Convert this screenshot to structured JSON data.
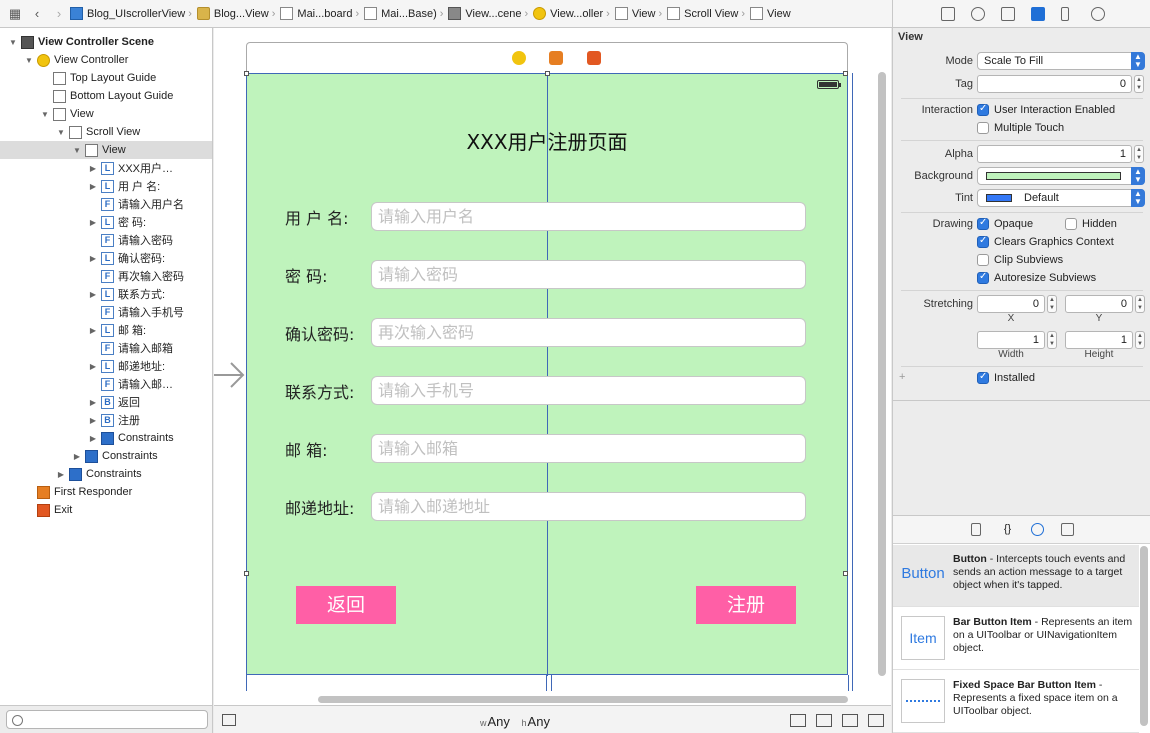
{
  "jumpbar": {
    "crumbs": [
      {
        "label": "Blog_UIscrollerView",
        "icon": "project-icon"
      },
      {
        "label": "Blog...View",
        "icon": "folder-icon"
      },
      {
        "label": "Mai...board",
        "icon": "storyboard-file-icon"
      },
      {
        "label": "Mai...Base)",
        "icon": "storyboard-file-icon"
      },
      {
        "label": "View...cene",
        "icon": "scene-icon"
      },
      {
        "label": "View...oller",
        "icon": "view-controller-icon"
      },
      {
        "label": "View",
        "icon": "view-icon"
      },
      {
        "label": "Scroll View",
        "icon": "view-icon"
      },
      {
        "label": "View",
        "icon": "view-icon"
      }
    ]
  },
  "outline": {
    "items": [
      {
        "label": "View Controller Scene",
        "indent": 0,
        "disclosure": "open",
        "icon": "scene-icon",
        "bold": true
      },
      {
        "label": "View Controller",
        "indent": 1,
        "disclosure": "open",
        "icon": "view-controller-icon"
      },
      {
        "label": "Top Layout Guide",
        "indent": 2,
        "disclosure": "none",
        "icon": "layout-guide-icon"
      },
      {
        "label": "Bottom Layout Guide",
        "indent": 2,
        "disclosure": "none",
        "icon": "layout-guide-icon"
      },
      {
        "label": "View",
        "indent": 2,
        "disclosure": "open",
        "icon": "view-icon"
      },
      {
        "label": "Scroll View",
        "indent": 3,
        "disclosure": "open",
        "icon": "view-icon"
      },
      {
        "label": "View",
        "indent": 4,
        "disclosure": "open",
        "icon": "view-icon",
        "selected": true
      },
      {
        "label": "XXX用户…",
        "indent": 5,
        "disclosure": "closed",
        "icon": "label-icon",
        "glyph": "L"
      },
      {
        "label": "用 户 名:",
        "indent": 5,
        "disclosure": "closed",
        "icon": "label-icon",
        "glyph": "L"
      },
      {
        "label": "请输入用户名",
        "indent": 5,
        "disclosure": "none",
        "icon": "text-field-icon",
        "glyph": "F"
      },
      {
        "label": "密      码:",
        "indent": 5,
        "disclosure": "closed",
        "icon": "label-icon",
        "glyph": "L"
      },
      {
        "label": "请输入密码",
        "indent": 5,
        "disclosure": "none",
        "icon": "text-field-icon",
        "glyph": "F"
      },
      {
        "label": "确认密码:",
        "indent": 5,
        "disclosure": "closed",
        "icon": "label-icon",
        "glyph": "L"
      },
      {
        "label": "再次输入密码",
        "indent": 5,
        "disclosure": "none",
        "icon": "text-field-icon",
        "glyph": "F"
      },
      {
        "label": "联系方式:",
        "indent": 5,
        "disclosure": "closed",
        "icon": "label-icon",
        "glyph": "L"
      },
      {
        "label": "请输入手机号",
        "indent": 5,
        "disclosure": "none",
        "icon": "text-field-icon",
        "glyph": "F"
      },
      {
        "label": "邮      箱:",
        "indent": 5,
        "disclosure": "closed",
        "icon": "label-icon",
        "glyph": "L"
      },
      {
        "label": "请输入邮箱",
        "indent": 5,
        "disclosure": "none",
        "icon": "text-field-icon",
        "glyph": "F"
      },
      {
        "label": "邮递地址:",
        "indent": 5,
        "disclosure": "closed",
        "icon": "label-icon",
        "glyph": "L"
      },
      {
        "label": "请输入邮…",
        "indent": 5,
        "disclosure": "none",
        "icon": "text-field-icon",
        "glyph": "F"
      },
      {
        "label": "返回",
        "indent": 5,
        "disclosure": "closed",
        "icon": "button-icon",
        "glyph": "B"
      },
      {
        "label": "注册",
        "indent": 5,
        "disclosure": "closed",
        "icon": "button-icon",
        "glyph": "B"
      },
      {
        "label": "Constraints",
        "indent": 5,
        "disclosure": "closed",
        "icon": "constraints-icon"
      },
      {
        "label": "Constraints",
        "indent": 4,
        "disclosure": "closed",
        "icon": "constraints-icon"
      },
      {
        "label": "Constraints",
        "indent": 3,
        "disclosure": "closed",
        "icon": "constraints-icon"
      },
      {
        "label": "First Responder",
        "indent": 1,
        "disclosure": "none",
        "icon": "first-responder-icon"
      },
      {
        "label": "Exit",
        "indent": 1,
        "disclosure": "none",
        "icon": "exit-icon"
      }
    ]
  },
  "form": {
    "title": "XXX用户注册页面",
    "fields": [
      {
        "label": "用 户 名:",
        "placeholder": "请输入用户名"
      },
      {
        "label": "密      码:",
        "placeholder": "请输入密码"
      },
      {
        "label": "确认密码:",
        "placeholder": "再次输入密码"
      },
      {
        "label": "联系方式:",
        "placeholder": "请输入手机号"
      },
      {
        "label": "邮      箱:",
        "placeholder": "请输入邮箱"
      },
      {
        "label": "邮递地址:",
        "placeholder": "请输入邮递地址"
      }
    ],
    "back_button": "返回",
    "register_button": "注册",
    "background_color": "#bff3bc",
    "button_color": "#ff5fa6"
  },
  "canvas_bottom": {
    "w_prefix": "w",
    "w_value": "Any",
    "h_prefix": "h",
    "h_value": "Any"
  },
  "inspector": {
    "section_title": "View",
    "mode_label": "Mode",
    "mode_value": "Scale To Fill",
    "tag_label": "Tag",
    "tag_value": "0",
    "interaction_label": "Interaction",
    "user_interaction": {
      "label": "User Interaction Enabled",
      "checked": true
    },
    "multiple_touch": {
      "label": "Multiple Touch",
      "checked": false
    },
    "alpha_label": "Alpha",
    "alpha_value": "1",
    "background_label": "Background",
    "tint_label": "Tint",
    "tint_value": "Default",
    "drawing_label": "Drawing",
    "opaque": {
      "label": "Opaque",
      "checked": true
    },
    "hidden": {
      "label": "Hidden",
      "checked": false
    },
    "clears_graphics": {
      "label": "Clears Graphics Context",
      "checked": true
    },
    "clip_subviews": {
      "label": "Clip Subviews",
      "checked": false
    },
    "autoresize_subviews": {
      "label": "Autoresize Subviews",
      "checked": true
    },
    "stretching_label": "Stretching",
    "stretch_x": "0",
    "stretch_y": "0",
    "x_label": "X",
    "y_label": "Y",
    "stretch_width": "1",
    "stretch_height": "1",
    "width_label": "Width",
    "height_label": "Height",
    "installed": {
      "label": "Installed",
      "checked": true
    }
  },
  "library": {
    "items": [
      {
        "thumb": "Button",
        "name": "Button",
        "desc": " - Intercepts touch events and sends an action message to a target object when it's tapped."
      },
      {
        "thumb": "Item",
        "name": "Bar Button Item",
        "desc": " - Represents an item on a UIToolbar or UINavigationItem object."
      },
      {
        "thumb": "",
        "name": "Fixed Space Bar Button Item",
        "desc": " - Represents a fixed space item on a UIToolbar object."
      }
    ]
  }
}
